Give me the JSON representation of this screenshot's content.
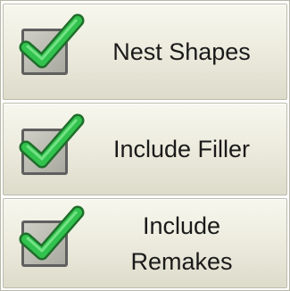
{
  "options": [
    {
      "label": "Nest Shapes",
      "checked": true
    },
    {
      "label": "Include Filler",
      "checked": true
    },
    {
      "label_line1": "Include",
      "label_line2": "Remakes",
      "checked": true
    }
  ],
  "colors": {
    "check_green": "#2fb84a",
    "check_outline": "#1f6e2b",
    "checkbox_border": "#5f5f5f"
  },
  "icons": [
    "checkmark-icon",
    "checkmark-icon",
    "checkmark-icon"
  ]
}
